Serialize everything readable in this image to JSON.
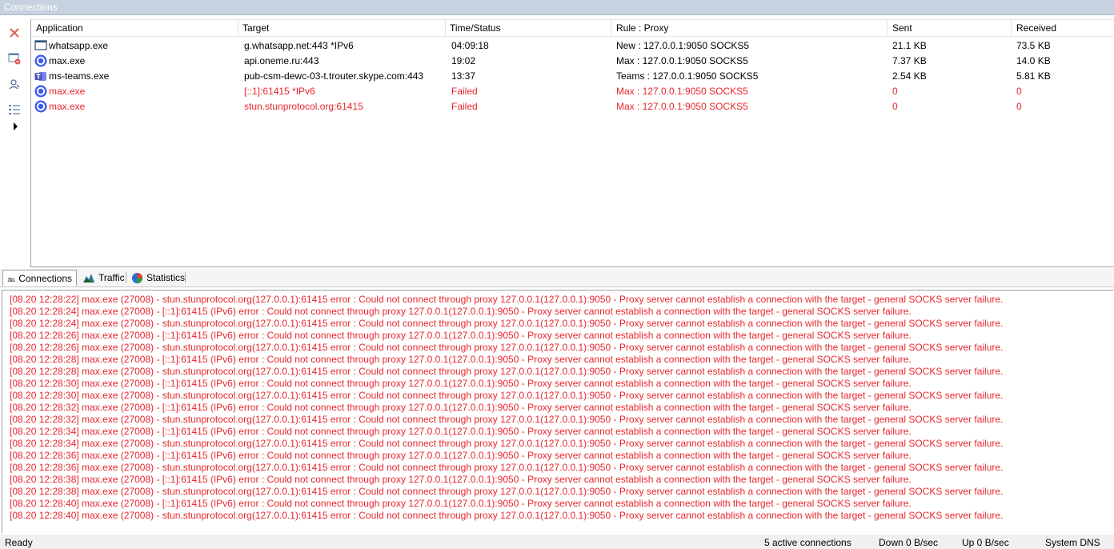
{
  "window": {
    "title": "Connections"
  },
  "toolbar": {
    "buttons": [
      {
        "name": "close-connection",
        "icon": "x-icon"
      },
      {
        "name": "block",
        "icon": "block-window-icon"
      },
      {
        "name": "find",
        "icon": "search-user-icon"
      },
      {
        "name": "list-view",
        "icon": "list-icon"
      },
      {
        "name": "expand",
        "icon": "play-arrow-icon"
      }
    ]
  },
  "grid": {
    "columns": [
      "Application",
      "Target",
      "Time/Status",
      "Rule : Proxy",
      "Sent",
      "Received"
    ],
    "rows": [
      {
        "app": "whatsapp.exe",
        "icon": "window-app-icon",
        "target": "g.whatsapp.net:443 *IPv6",
        "time": "04:09:18",
        "rule": "New : 127.0.0.1:9050 SOCKS5",
        "sent": "21.1 KB",
        "received": "73.5 KB",
        "failed": false
      },
      {
        "app": "max.exe",
        "icon": "max-app-icon",
        "target": "api.oneme.ru:443",
        "time": "19:02",
        "rule": "Max : 127.0.0.1:9050 SOCKS5",
        "sent": "7.37 KB",
        "received": "14.0 KB",
        "failed": false
      },
      {
        "app": "ms-teams.exe",
        "icon": "teams-app-icon",
        "target": "pub-csm-dewc-03-t.trouter.skype.com:443",
        "time": "13:37",
        "rule": "Teams : 127.0.0.1:9050 SOCKS5",
        "sent": "2.54 KB",
        "received": "5.81 KB",
        "failed": false
      },
      {
        "app": "max.exe",
        "icon": "max-app-icon",
        "target": "[::1]:61415 *IPv6",
        "time": "Failed",
        "rule": "Max : 127.0.0.1:9050 SOCKS5",
        "sent": "0",
        "received": "0",
        "failed": true
      },
      {
        "app": "max.exe",
        "icon": "max-app-icon",
        "target": "stun.stunprotocol.org:61415",
        "time": "Failed",
        "rule": "Max : 127.0.0.1:9050 SOCKS5",
        "sent": "0",
        "received": "0",
        "failed": true
      }
    ]
  },
  "tabs": [
    {
      "label": "Connections",
      "icon": "connections-icon",
      "active": true
    },
    {
      "label": "Traffic",
      "icon": "traffic-chart-icon",
      "active": false
    },
    {
      "label": "Statistics",
      "icon": "pie-chart-icon",
      "active": false
    }
  ],
  "log": [
    "[08.20 12:28:22] max.exe (27008) - stun.stunprotocol.org(127.0.0.1):61415 error : Could not connect through proxy 127.0.0.1(127.0.0.1):9050 - Proxy server cannot establish a connection with the target - general SOCKS server failure.",
    "[08.20 12:28:24] max.exe (27008) - [::1]:61415 (IPv6) error : Could not connect through proxy 127.0.0.1(127.0.0.1):9050 - Proxy server cannot establish a connection with the target - general SOCKS server failure.",
    "[08.20 12:28:24] max.exe (27008) - stun.stunprotocol.org(127.0.0.1):61415 error : Could not connect through proxy 127.0.0.1(127.0.0.1):9050 - Proxy server cannot establish a connection with the target - general SOCKS server failure.",
    "[08.20 12:28:26] max.exe (27008) - [::1]:61415 (IPv6) error : Could not connect through proxy 127.0.0.1(127.0.0.1):9050 - Proxy server cannot establish a connection with the target - general SOCKS server failure.",
    "[08.20 12:28:26] max.exe (27008) - stun.stunprotocol.org(127.0.0.1):61415 error : Could not connect through proxy 127.0.0.1(127.0.0.1):9050 - Proxy server cannot establish a connection with the target - general SOCKS server failure.",
    "[08.20 12:28:28] max.exe (27008) - [::1]:61415 (IPv6) error : Could not connect through proxy 127.0.0.1(127.0.0.1):9050 - Proxy server cannot establish a connection with the target - general SOCKS server failure.",
    "[08.20 12:28:28] max.exe (27008) - stun.stunprotocol.org(127.0.0.1):61415 error : Could not connect through proxy 127.0.0.1(127.0.0.1):9050 - Proxy server cannot establish a connection with the target - general SOCKS server failure.",
    "[08.20 12:28:30] max.exe (27008) - [::1]:61415 (IPv6) error : Could not connect through proxy 127.0.0.1(127.0.0.1):9050 - Proxy server cannot establish a connection with the target - general SOCKS server failure.",
    "[08.20 12:28:30] max.exe (27008) - stun.stunprotocol.org(127.0.0.1):61415 error : Could not connect through proxy 127.0.0.1(127.0.0.1):9050 - Proxy server cannot establish a connection with the target - general SOCKS server failure.",
    "[08.20 12:28:32] max.exe (27008) - [::1]:61415 (IPv6) error : Could not connect through proxy 127.0.0.1(127.0.0.1):9050 - Proxy server cannot establish a connection with the target - general SOCKS server failure.",
    "[08.20 12:28:32] max.exe (27008) - stun.stunprotocol.org(127.0.0.1):61415 error : Could not connect through proxy 127.0.0.1(127.0.0.1):9050 - Proxy server cannot establish a connection with the target - general SOCKS server failure.",
    "[08.20 12:28:34] max.exe (27008) - [::1]:61415 (IPv6) error : Could not connect through proxy 127.0.0.1(127.0.0.1):9050 - Proxy server cannot establish a connection with the target - general SOCKS server failure.",
    "[08.20 12:28:34] max.exe (27008) - stun.stunprotocol.org(127.0.0.1):61415 error : Could not connect through proxy 127.0.0.1(127.0.0.1):9050 - Proxy server cannot establish a connection with the target - general SOCKS server failure.",
    "[08.20 12:28:36] max.exe (27008) - [::1]:61415 (IPv6) error : Could not connect through proxy 127.0.0.1(127.0.0.1):9050 - Proxy server cannot establish a connection with the target - general SOCKS server failure.",
    "[08.20 12:28:36] max.exe (27008) - stun.stunprotocol.org(127.0.0.1):61415 error : Could not connect through proxy 127.0.0.1(127.0.0.1):9050 - Proxy server cannot establish a connection with the target - general SOCKS server failure.",
    "[08.20 12:28:38] max.exe (27008) - [::1]:61415 (IPv6) error : Could not connect through proxy 127.0.0.1(127.0.0.1):9050 - Proxy server cannot establish a connection with the target - general SOCKS server failure.",
    "[08.20 12:28:38] max.exe (27008) - stun.stunprotocol.org(127.0.0.1):61415 error : Could not connect through proxy 127.0.0.1(127.0.0.1):9050 - Proxy server cannot establish a connection with the target - general SOCKS server failure.",
    "[08.20 12:28:40] max.exe (27008) - [::1]:61415 (IPv6) error : Could not connect through proxy 127.0.0.1(127.0.0.1):9050 - Proxy server cannot establish a connection with the target - general SOCKS server failure.",
    "[08.20 12:28:40] max.exe (27008) - stun.stunprotocol.org(127.0.0.1):61415 error : Could not connect through proxy 127.0.0.1(127.0.0.1):9050 - Proxy server cannot establish a connection with the target - general SOCKS server failure."
  ],
  "status": {
    "ready": "Ready",
    "active": "5 active connections",
    "down": "Down 0 B/sec",
    "up": "Up 0 B/sec",
    "dns": "System DNS"
  },
  "colors": {
    "error": "#e8262d",
    "titlebar": "#c6d2df"
  }
}
